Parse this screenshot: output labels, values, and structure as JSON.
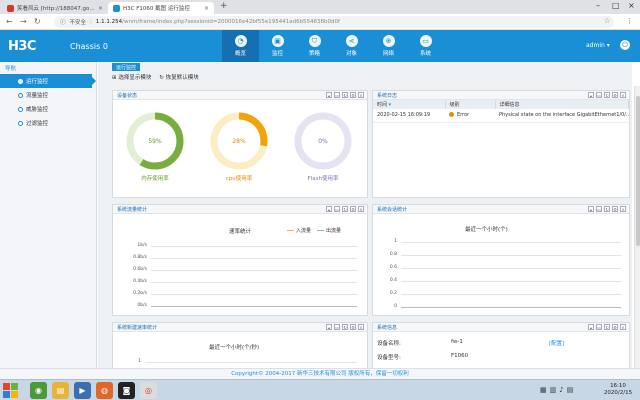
{
  "browser": {
    "tabs": [
      {
        "title": "笑看风云 [http://188047.gov..."
      },
      {
        "title": "H3C F1060 截图 运行监控"
      }
    ],
    "security_label": "不安全",
    "url_host": "1.1.1.254",
    "url_path": "/wnm/frame/index.php?sessionid=2000016e42bf55e195441ad6b554838b0d0f"
  },
  "app": {
    "logo": "H3C",
    "device_title": "Chassis 0",
    "user": "admin",
    "nav": [
      {
        "label": "概览",
        "icon": "dashboard-icon"
      },
      {
        "label": "监控",
        "icon": "monitor-icon"
      },
      {
        "label": "策略",
        "icon": "shield-icon"
      },
      {
        "label": "对象",
        "icon": "share-icon"
      },
      {
        "label": "网络",
        "icon": "globe-icon"
      },
      {
        "label": "系统",
        "icon": "desktop-icon"
      }
    ]
  },
  "sidebar": {
    "header": "导航",
    "items": [
      {
        "label": "运行监控"
      },
      {
        "label": "流量监控"
      },
      {
        "label": "威胁监控"
      },
      {
        "label": "过滤监控"
      }
    ]
  },
  "main": {
    "subtab": "运行监控",
    "toolbar": {
      "select_panels": "选择显示模块",
      "restore_default": "恢复默认模块"
    },
    "device_status": {
      "title": "设备状态",
      "gauges": [
        {
          "value_label": "59%",
          "value": 59,
          "label": "内存使用率",
          "color": "#7aad3f",
          "track": "#e3efd5",
          "text_color": "#6a9a34"
        },
        {
          "value_label": "28%",
          "value": 28,
          "label": "cpu使用率",
          "color": "#f0a30a",
          "track": "#fbedc4",
          "text_color": "#e08a00"
        },
        {
          "value_label": "0%",
          "value": 0,
          "label": "Flash使用率",
          "color": "#9b8fd0",
          "track": "#e6e2f4",
          "text_color": "#8070c0"
        }
      ]
    },
    "system_log": {
      "title": "系统日志",
      "columns": [
        "时间",
        "级别",
        "详细信息"
      ],
      "rows": [
        {
          "time": "2020-02-15 16:09:19",
          "level": "Error",
          "detail": "Physical state on the interface GigabitEthernet1/0/..."
        }
      ]
    },
    "traffic_stats": {
      "title": "系统流量统计",
      "chart_title": "速率统计",
      "legend": [
        "入流量",
        "出流量"
      ],
      "y_ticks": [
        "1b/s",
        "0.8b/s",
        "0.6b/s",
        "0.4b/s",
        "0.2b/s",
        "0b/s"
      ]
    },
    "session_stats": {
      "title": "系统会话统计",
      "chart_title": "最近一个小时(个)",
      "y_ticks": [
        "1",
        "0.8",
        "0.6",
        "0.4",
        "0.2",
        "0"
      ]
    },
    "new_session_rate": {
      "title": "系统新建速率统计",
      "chart_title": "最近一个小时(个/秒)",
      "y_ticks": [
        "1"
      ]
    },
    "system_info": {
      "title": "系统信息",
      "rows": [
        {
          "label": "设备名称:",
          "value": "fw-1"
        },
        {
          "label": "设备型号:",
          "value": "F1060"
        }
      ],
      "config_link": "[配置]"
    }
  },
  "footer": {
    "text": "Copyright© 2004-2017 新华三技术有限公司 版权所有，保留一切权利"
  },
  "taskbar": {
    "time": "16:10",
    "date": "2020/2/15"
  }
}
